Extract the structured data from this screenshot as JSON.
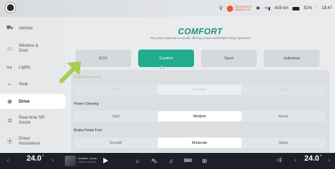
{
  "status": {
    "airbag_line1": "PASSENGER",
    "airbag_line2": "AIRBAG ON",
    "range": "416 km",
    "battery_pct": "81%",
    "time": "18:47"
  },
  "sidebar": {
    "items": [
      {
        "label": "Vehicle",
        "icon": "car-icon"
      },
      {
        "label": "Window &\nDoor",
        "icon": "window-icon"
      },
      {
        "label": "Lights",
        "icon": "lights-icon"
      },
      {
        "label": "Seat",
        "icon": "seat-icon"
      },
      {
        "label": "Drive",
        "icon": "steering-wheel-icon",
        "active": true
      },
      {
        "label": "Real-time SR\nAssist",
        "icon": "sr-assist-icon"
      },
      {
        "label": "Driver\nAssistance",
        "icon": "driver-assistance-icon"
      }
    ]
  },
  "drive": {
    "mode_title": "COMFORT",
    "mode_desc": "The power response is smooth, offering a more comfortable riding experience",
    "modes": [
      "ECO",
      "Comfort",
      "Sport",
      "Individual"
    ],
    "active_mode": "Comfort",
    "power_response": {
      "label": "Power Response",
      "options": [
        "ECO",
        "Comfort",
        "Sport"
      ],
      "selected": "Comfort",
      "enabled": false
    },
    "power_steering": {
      "label": "Power Steering",
      "options": [
        "Light",
        "Medium",
        "Heavy"
      ],
      "selected": "Medium",
      "enabled": true
    },
    "brake_pedal": {
      "label": "Brake Pedal Feel",
      "options": [
        "Smooth",
        "Moderate",
        "Sharp"
      ],
      "selected": "Moderate",
      "enabled": true
    }
  },
  "dock": {
    "left_temp": "24.0",
    "right_temp": "24.0",
    "degree": "°",
    "media_title": "Anytime, Anyw...",
    "media_artist": "Various Artists",
    "camera_360": "360"
  },
  "colors": {
    "accent": "#1fad8e",
    "title": "#1a8e7a",
    "arrow": "#a6cc52",
    "dock_bg": "#1d2026"
  }
}
